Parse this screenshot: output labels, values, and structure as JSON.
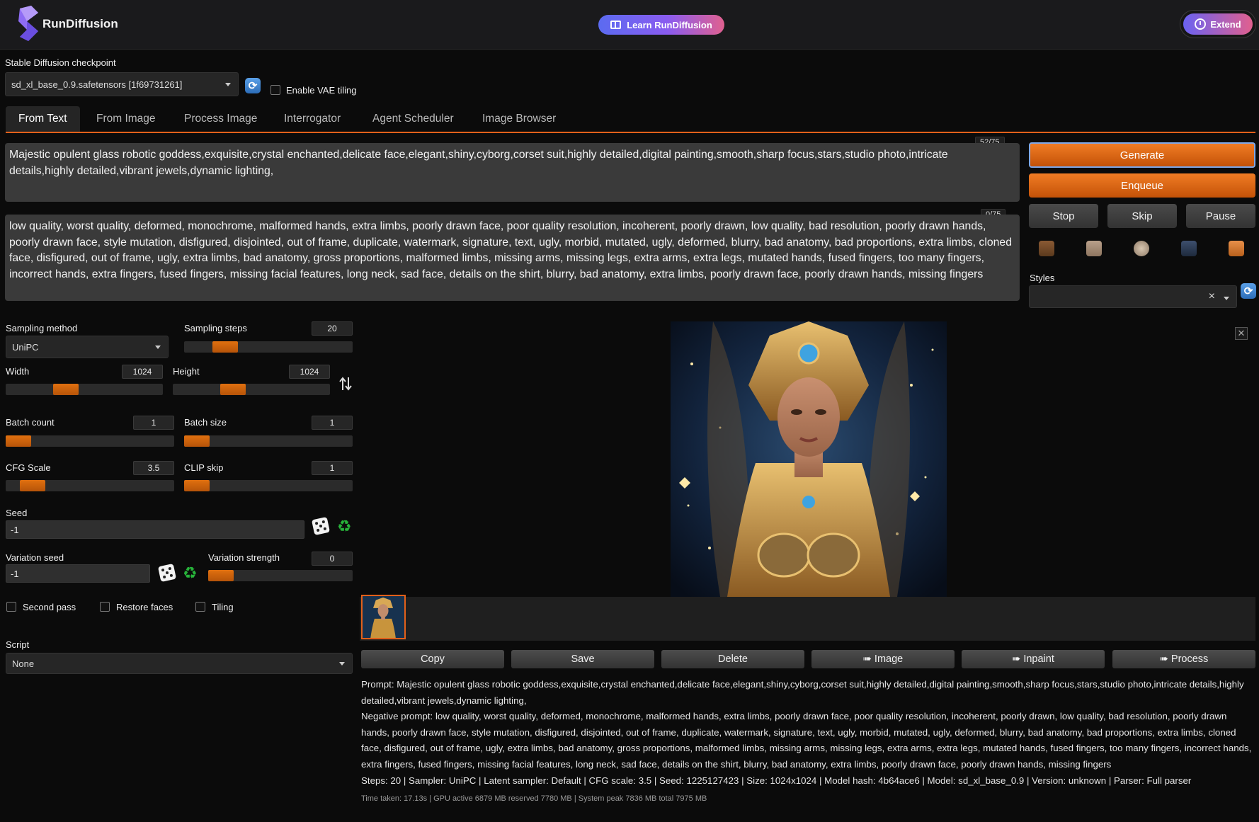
{
  "header": {
    "brand": "RunDiffusion",
    "learn_label": "Learn RunDiffusion",
    "extend_label": "Extend"
  },
  "checkpoint": {
    "label": "Stable Diffusion checkpoint",
    "value": "sd_xl_base_0.9.safetensors [1f69731261]",
    "vae_label": "Enable VAE tiling"
  },
  "tabs": [
    "From Text",
    "From Image",
    "Process Image",
    "Interrogator",
    "Agent Scheduler",
    "Image Browser"
  ],
  "prompt": {
    "counter": "52/75",
    "text": "Majestic opulent glass robotic goddess,exquisite,crystal enchanted,delicate face,elegant,shiny,cyborg,corset suit,highly detailed,digital painting,smooth,sharp focus,stars,studio photo,intricate details,highly detailed,vibrant jewels,dynamic lighting,"
  },
  "negative": {
    "counter": "0/75",
    "text": "low quality, worst quality, deformed, monochrome, malformed hands, extra limbs, poorly drawn face, poor quality resolution, incoherent, poorly drawn, low quality, bad resolution, poorly drawn hands, poorly drawn face, style mutation, disfigured, disjointed, out of frame, duplicate, watermark, signature, text, ugly, morbid, mutated, ugly, deformed, blurry, bad anatomy, bad proportions, extra limbs, cloned face, disfigured, out of frame, ugly, extra limbs, bad anatomy, gross proportions, malformed limbs, missing arms, missing legs, extra arms, extra legs, mutated hands, fused fingers, too many fingers, incorrect hands, extra fingers, fused fingers, missing facial features, long neck, sad face, details on the shirt, blurry, bad anatomy, extra limbs, poorly drawn face, poorly drawn hands, missing fingers"
  },
  "actions": {
    "generate": "Generate",
    "enqueue": "Enqueue",
    "stop": "Stop",
    "skip": "Skip",
    "pause": "Pause"
  },
  "styles": {
    "label": "Styles",
    "clear": "×"
  },
  "settings": {
    "sampling_method_label": "Sampling method",
    "sampling_method": "UniPC",
    "sampling_steps_label": "Sampling steps",
    "sampling_steps": "20",
    "sampling_steps_level": 0.2,
    "width_label": "Width",
    "width": "1024",
    "width_level": 0.36,
    "height_label": "Height",
    "height": "1024",
    "height_level": 0.36,
    "batch_count_label": "Batch count",
    "batch_count": "1",
    "batch_count_level": 0.0,
    "batch_size_label": "Batch size",
    "batch_size": "1",
    "batch_size_level": 0.0,
    "cfg_label": "CFG Scale",
    "cfg": "3.5",
    "cfg_level": 0.1,
    "clip_label": "CLIP skip",
    "clip": "1",
    "clip_level": 0.0,
    "seed_label": "Seed",
    "seed": "-1",
    "var_seed_label": "Variation seed",
    "var_seed": "-1",
    "var_strength_label": "Variation strength",
    "var_strength": "0",
    "var_strength_level": 0.0,
    "second_pass": "Second pass",
    "restore_faces": "Restore faces",
    "tiling": "Tiling",
    "script_label": "Script",
    "script": "None"
  },
  "output_buttons": [
    "Copy",
    "Save",
    "Delete",
    "➠ Image",
    "➠ Inpaint",
    "➠ Process"
  ],
  "info": {
    "prompt_line": "Prompt: Majestic opulent glass robotic goddess,exquisite,crystal enchanted,delicate face,elegant,shiny,cyborg,corset suit,highly detailed,digital painting,smooth,sharp focus,stars,studio photo,intricate details,highly detailed,vibrant jewels,dynamic lighting,",
    "negative_line": "Negative prompt: low quality, worst quality, deformed, monochrome, malformed hands, extra limbs, poorly drawn face, poor quality resolution, incoherent, poorly drawn, low quality, bad resolution, poorly drawn hands, poorly drawn face, style mutation, disfigured, disjointed, out of frame, duplicate, watermark, signature, text, ugly, morbid, mutated, ugly, deformed, blurry, bad anatomy, bad proportions, extra limbs, cloned face, disfigured, out of frame, ugly, extra limbs, bad anatomy, gross proportions, malformed limbs, missing arms, missing legs, extra arms, extra legs, mutated hands, fused fingers, too many fingers, incorrect hands, extra fingers, fused fingers, missing facial features, long neck, sad face, details on the shirt, blurry, bad anatomy, extra limbs, poorly drawn face, poorly drawn hands, missing fingers",
    "params_line": "Steps: 20 | Sampler: UniPC | Latent sampler: Default | CFG scale: 3.5 | Seed: 1225127423 | Size: 1024x1024 | Model hash: 4b64ace6 | Model: sd_xl_base_0.9 | Version: unknown | Parser: Full parser",
    "time_line": "Time taken: 17.13s | GPU active 6879 MB reserved 7780 MB | System peak 7836 MB total 7975 MB"
  },
  "colors": {
    "accent": "#e2601a",
    "generate": "#e8701a",
    "recycle": "#27b33a"
  }
}
